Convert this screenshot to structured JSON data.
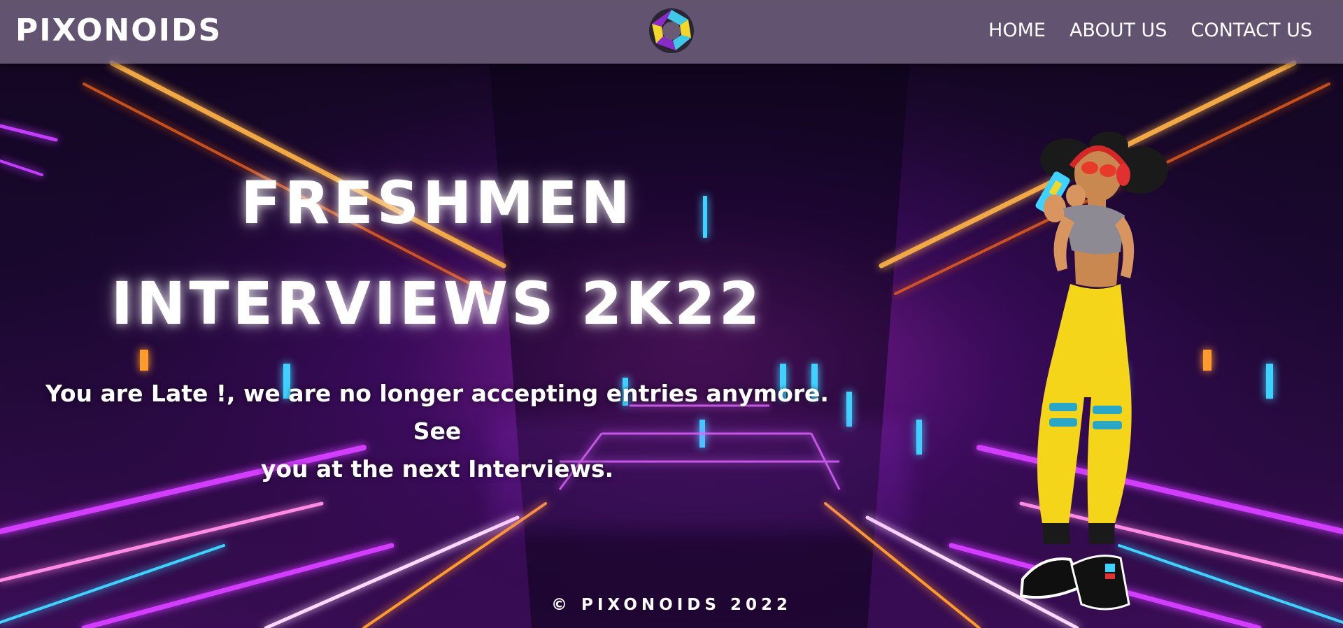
{
  "header": {
    "brand": "PIXONOIDS",
    "logo_icon": "aperture-logo-icon",
    "nav": [
      {
        "label": "HOME"
      },
      {
        "label": "ABOUT US"
      },
      {
        "label": "CONTACT US"
      }
    ]
  },
  "hero": {
    "title_line1": "FRESHMEN",
    "title_line2": "INTERVIEWS 2K22",
    "subtitle_line1": "You are Late !, we are no longer accepting entries anymore. See",
    "subtitle_line2": "you at the next Interviews.",
    "illustration_icon": "character-illustration"
  },
  "footer": {
    "copyright": "© PIXONOIDS 2022"
  },
  "colors": {
    "header_bg": "#786987",
    "neon_magenta": "#d23cff",
    "neon_cyan": "#3fd2ff",
    "neon_orange": "#ff9a2e",
    "text": "#ffffff"
  }
}
